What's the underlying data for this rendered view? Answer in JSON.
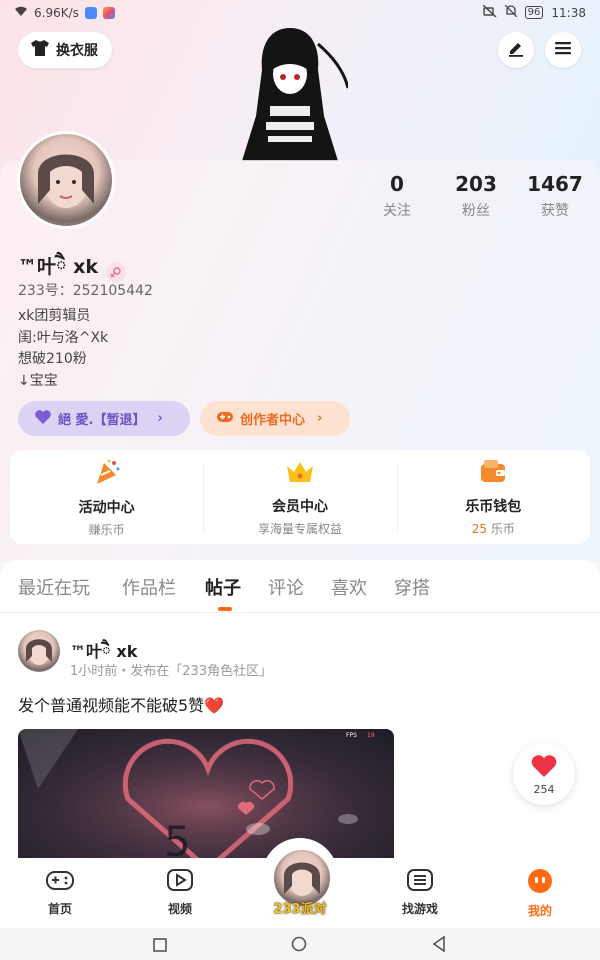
{
  "status": {
    "speed": "6.96K/s",
    "battery": "96",
    "time": "11:38"
  },
  "header": {
    "costume_label": "换衣服"
  },
  "profile": {
    "name": "™叶ཻ xk",
    "uid_label": "233号：",
    "uid": "252105442",
    "bio": [
      "xk团剪辑员",
      "闺:叶与洛^Xk",
      "想破210粉",
      "↓宝宝"
    ],
    "stats": [
      {
        "value": "0",
        "label": "关注"
      },
      {
        "value": "203",
        "label": "粉丝"
      },
      {
        "value": "1467",
        "label": "获赞"
      }
    ],
    "tag_1": "絕 愛.【暂退】",
    "tag_2": "创作者中心"
  },
  "services": [
    {
      "title": "活动中心",
      "sub": "赚乐币"
    },
    {
      "title": "会员中心",
      "sub": "享海量专属权益"
    },
    {
      "title": "乐币钱包",
      "sub_value": "25",
      "sub": "乐币"
    }
  ],
  "tabs": [
    "最近在玩",
    "作品栏",
    "帖子",
    "评论",
    "喜欢",
    "穿搭"
  ],
  "post": {
    "name": "™叶ཻ xk",
    "meta": "1小时前・发布在「233角色社区」",
    "text": "发个普通视频能不能破5赞❤️",
    "image_fps": "FPS",
    "image_fps_value": "19",
    "image_num": "5",
    "likes": "254"
  },
  "nav": {
    "home": "首页",
    "video": "视频",
    "center": "233派对",
    "games": "找游戏",
    "mine": "我的"
  },
  "colors": {
    "accent": "#ff6a13",
    "tag1_bg": "#dcd3f4",
    "tag2_bg": "#fde2d2",
    "like": "#ee3344"
  }
}
